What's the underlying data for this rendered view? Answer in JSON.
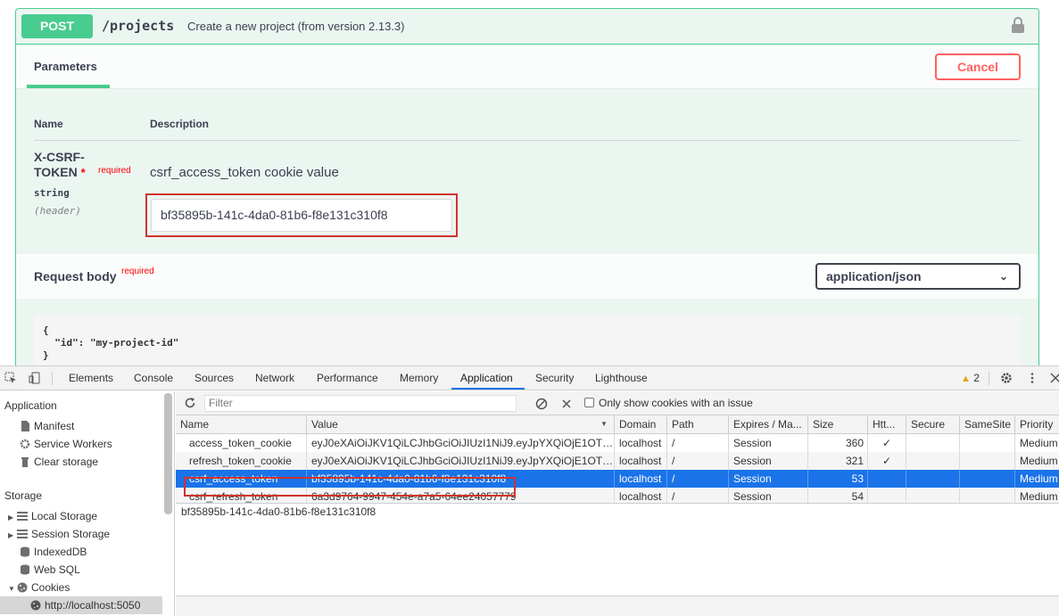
{
  "swagger": {
    "method": "POST",
    "path": "/projects",
    "summary": "Create a new project (from version 2.13.3)",
    "tab_parameters": "Parameters",
    "cancel_label": "Cancel",
    "col_name": "Name",
    "col_description": "Description",
    "param": {
      "name_line1": "X-CSRF-",
      "name_line2": "TOKEN",
      "star": "*",
      "required": "required",
      "type": "string",
      "in": "(header)",
      "description": "csrf_access_token cookie value",
      "value": "bf35895b-141c-4da0-81b6-f8e131c310f8"
    },
    "request_body": {
      "title": "Request body",
      "required": "required",
      "content_type": "application/json",
      "example": "{\n  \"id\": \"my-project-id\"\n}"
    }
  },
  "devtools": {
    "tabs": [
      "Elements",
      "Console",
      "Sources",
      "Network",
      "Performance",
      "Memory",
      "Application",
      "Security",
      "Lighthouse"
    ],
    "active_tab": "Application",
    "warnings_count": "2",
    "sidebar": {
      "application_header": "Application",
      "application_items": [
        "Manifest",
        "Service Workers",
        "Clear storage"
      ],
      "storage_header": "Storage",
      "storage_items": [
        "Local Storage",
        "Session Storage",
        "IndexedDB",
        "Web SQL",
        "Cookies"
      ],
      "cookies_child": "http://localhost:5050"
    },
    "toolbar": {
      "filter_placeholder": "Filter",
      "only_issue_label": "Only show cookies with an issue"
    },
    "columns": [
      "Name",
      "Value",
      "Domain",
      "Path",
      "Expires / Ma...",
      "Size",
      "Htt...",
      "Secure",
      "SameSite",
      "Priority"
    ],
    "rows": [
      {
        "name": "access_token_cookie",
        "value": "eyJ0eXAiOiJKV1QiLCJhbGciOiJIUzI1NiJ9.eyJpYXQiOjE1OTE...",
        "domain": "localhost",
        "path": "/",
        "expires": "Session",
        "size": "360",
        "http": "✓",
        "secure": "",
        "samesite": "",
        "priority": "Medium"
      },
      {
        "name": "refresh_token_cookie",
        "value": "eyJ0eXAiOiJKV1QiLCJhbGciOiJIUzI1NiJ9.eyJpYXQiOjE1OTE...",
        "domain": "localhost",
        "path": "/",
        "expires": "Session",
        "size": "321",
        "http": "✓",
        "secure": "",
        "samesite": "",
        "priority": "Medium"
      },
      {
        "name": "csrf_access_token",
        "value": "bf35895b-141c-4da0-81b6-f8e131c310f8",
        "domain": "localhost",
        "path": "/",
        "expires": "Session",
        "size": "53",
        "http": "",
        "secure": "",
        "samesite": "",
        "priority": "Medium"
      },
      {
        "name": "csrf_refresh_token",
        "value": "6a3d9764-9947-454e-a7a5-64ee24057779",
        "domain": "localhost",
        "path": "/",
        "expires": "Session",
        "size": "54",
        "http": "",
        "secure": "",
        "samesite": "",
        "priority": "Medium"
      }
    ],
    "selected_row": 2,
    "selected_value": "bf35895b-141c-4da0-81b6-f8e131c310f8"
  },
  "colors": {
    "post_green": "#49cc90",
    "cancel_red": "#ff6060",
    "highlight_red": "#d0332b",
    "selection_blue": "#1a73e8"
  }
}
